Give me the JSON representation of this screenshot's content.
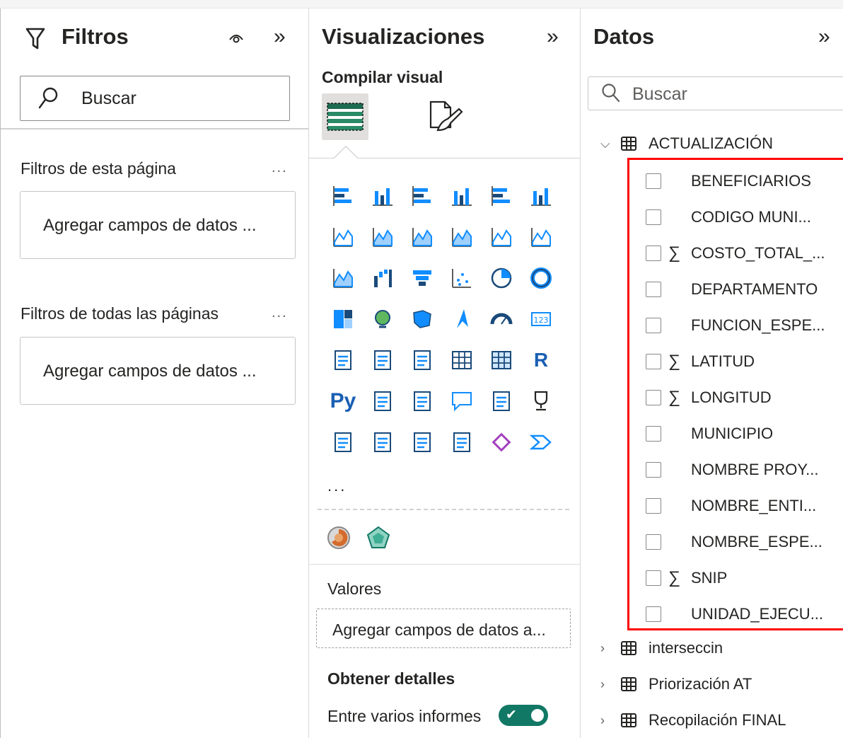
{
  "filters": {
    "title": "Filtros",
    "search_placeholder": "Buscar",
    "page_section": "Filtros de esta página",
    "all_pages_section": "Filtros de todas las páginas",
    "more": "...",
    "add_fields": "Agregar campos de datos ..."
  },
  "viz": {
    "title": "Visualizaciones",
    "build_label": "Compilar visual",
    "more": "...",
    "values_label": "Valores",
    "values_placeholder": "Agregar campos de datos a...",
    "drillthrough_label": "Obtener detalles",
    "cross_report_label": "Entre varios informes",
    "cross_report_on": true,
    "icons": [
      [
        "stacked-bar-chart",
        "stacked-column-chart",
        "clustered-bar-chart",
        "clustered-column-chart",
        "100-stacked-bar-chart",
        "100-stacked-column-chart"
      ],
      [
        "line-chart",
        "area-chart",
        "stacked-area-chart",
        "100-stacked-area-chart",
        "line-and-stacked-column-chart",
        "line-and-clustered-column-chart"
      ],
      [
        "ribbon-chart",
        "waterfall-chart",
        "funnel-chart",
        "scatter-chart",
        "pie-chart",
        "donut-chart"
      ],
      [
        "treemap",
        "map",
        "filled-map",
        "azure-map",
        "gauge",
        "card"
      ],
      [
        "multi-row-card",
        "kpi",
        "slicer",
        "table",
        "matrix",
        "r-visual"
      ],
      [
        "python-visual",
        "key-influencers",
        "decomposition-tree",
        "qna",
        "smart-narrative",
        "goals"
      ],
      [
        "paginated-report",
        "power-apps-card",
        "power-apps-slicer",
        "power-automate",
        "power-apps",
        "arcgis-map"
      ]
    ],
    "accent": "#118dff",
    "teal": "#117865"
  },
  "data": {
    "title": "Datos",
    "search_placeholder": "Buscar",
    "expanded_table": "ACTUALIZACIÓN",
    "fields": [
      {
        "name": "BENEFICIARIOS",
        "sum": false
      },
      {
        "name": "CODIGO MUNI...",
        "sum": false
      },
      {
        "name": "COSTO_TOTAL_...",
        "sum": true
      },
      {
        "name": "DEPARTAMENTO",
        "sum": false
      },
      {
        "name": "FUNCION_ESPE...",
        "sum": false
      },
      {
        "name": "LATITUD",
        "sum": true
      },
      {
        "name": "LONGITUD",
        "sum": true
      },
      {
        "name": "MUNICIPIO",
        "sum": false
      },
      {
        "name": "NOMBRE PROY...",
        "sum": false
      },
      {
        "name": "NOMBRE_ENTI...",
        "sum": false
      },
      {
        "name": "NOMBRE_ESPE...",
        "sum": false
      },
      {
        "name": "SNIP",
        "sum": true
      },
      {
        "name": "UNIDAD_EJECU...",
        "sum": false
      }
    ],
    "sum_glyph": "∑",
    "collapsed_tables": [
      "interseccin",
      "Priorización AT",
      "Recopilación FINAL"
    ],
    "highlight_color": "#ff0000"
  }
}
